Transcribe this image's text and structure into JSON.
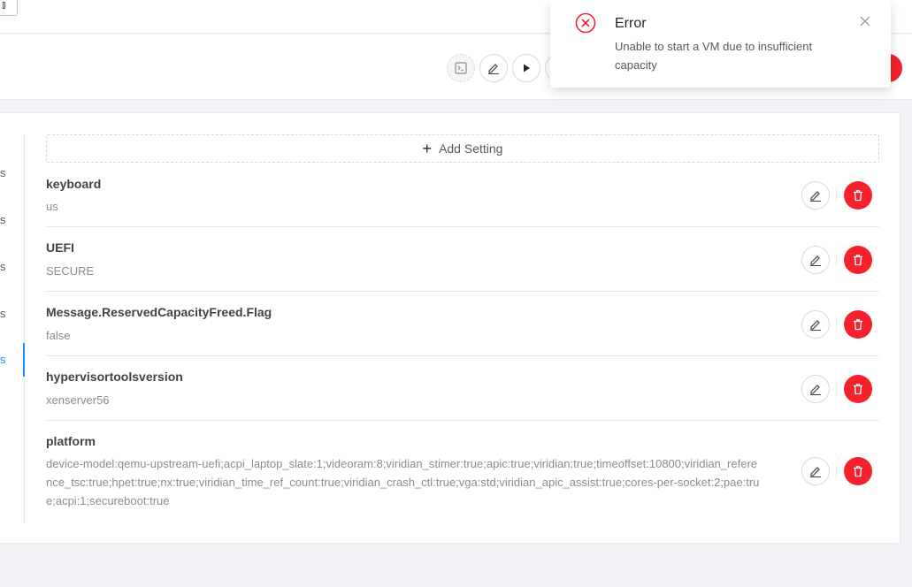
{
  "header": {
    "actions": [
      {
        "name": "console-button",
        "icon": "console-icon",
        "state": "disabled"
      },
      {
        "name": "edit-button",
        "icon": "pencil-icon"
      },
      {
        "name": "start-button",
        "icon": "play-icon"
      }
    ]
  },
  "sidebar": {
    "tabs": [
      {
        "label": "s",
        "active": false
      },
      {
        "label": "s",
        "active": false
      },
      {
        "label": "s",
        "active": false
      },
      {
        "label": "s",
        "active": false
      },
      {
        "label": "s",
        "active": true
      }
    ]
  },
  "settings": {
    "add_label": "Add Setting",
    "items": [
      {
        "name": "keyboard",
        "value": "us"
      },
      {
        "name": "UEFI",
        "value": "SECURE"
      },
      {
        "name": "Message.ReservedCapacityFreed.Flag",
        "value": "false"
      },
      {
        "name": "hypervisortoolsversion",
        "value": "xenserver56"
      },
      {
        "name": "platform",
        "value": "device-model:qemu-upstream-uefi;acpi_laptop_slate:1;videoram:8;viridian_stimer:true;apic:true;viridian:true;timeoffset:10800;viridian_reference_tsc:true;hpet:true;nx:true;viridian_time_ref_count:true;viridian_crash_ctl:true;vga:std;viridian_apic_assist:true;cores-per-socket:2;pae:true;acpi:1;secureboot:true"
      }
    ]
  },
  "notification": {
    "type": "error",
    "icon": "close-circle-icon",
    "title": "Error",
    "message": "Unable to start a VM due to insufficient capacity"
  },
  "colors": {
    "danger": "#f5222d",
    "primary": "#1890ff"
  }
}
